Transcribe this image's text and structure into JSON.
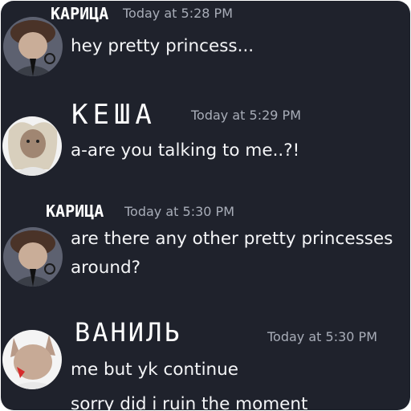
{
  "messages": [
    {
      "author": "КАРИЦА",
      "time": "Today at 5:28 PM",
      "lines": [
        "hey pretty princess..."
      ]
    },
    {
      "author": "КЕША",
      "time": "Today at 5:29 PM",
      "lines": [
        "a-are you talking to me..?!"
      ]
    },
    {
      "author": "КАРИЦА",
      "time": "Today at 5:30 PM",
      "lines": [
        "are there any other pretty princesses",
        "around?"
      ]
    },
    {
      "author": "ВАНИЛЬ",
      "time": "Today at 5:30 PM",
      "lines": [
        "me but yk continue",
        "sorry did i ruin the moment"
      ]
    }
  ],
  "colors": {
    "background": "#1f222c",
    "text": "#f4f5f7",
    "timestamp": "#a8adb8"
  },
  "icons": [
    "avatar-karitsa",
    "avatar-kesha",
    "avatar-karitsa",
    "avatar-vanil"
  ]
}
